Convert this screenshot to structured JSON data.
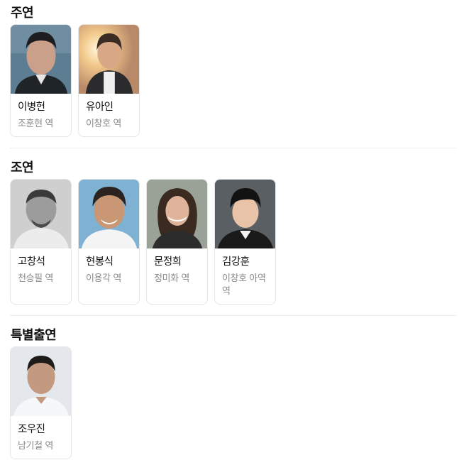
{
  "sections": [
    {
      "title": "주연",
      "cast": [
        {
          "name": "이병헌",
          "role": "조훈현 역",
          "photo_icon": "portrait-photo"
        },
        {
          "name": "유아인",
          "role": "이창호 역",
          "photo_icon": "portrait-photo"
        }
      ]
    },
    {
      "title": "조연",
      "cast": [
        {
          "name": "고창석",
          "role": "천승필 역",
          "photo_icon": "portrait-photo"
        },
        {
          "name": "현봉식",
          "role": "이용각 역",
          "photo_icon": "portrait-photo"
        },
        {
          "name": "문정희",
          "role": "정미화 역",
          "photo_icon": "portrait-photo"
        },
        {
          "name": "김강훈",
          "role": "이창호 아역 역",
          "photo_icon": "portrait-photo"
        }
      ]
    },
    {
      "title": "특별출연",
      "cast": [
        {
          "name": "조우진",
          "role": "남기철 역",
          "photo_icon": "portrait-photo"
        }
      ]
    }
  ],
  "colors": {
    "card_border": "#e6e6e6",
    "role_text": "#8a8a8a",
    "divider": "#ececec"
  }
}
